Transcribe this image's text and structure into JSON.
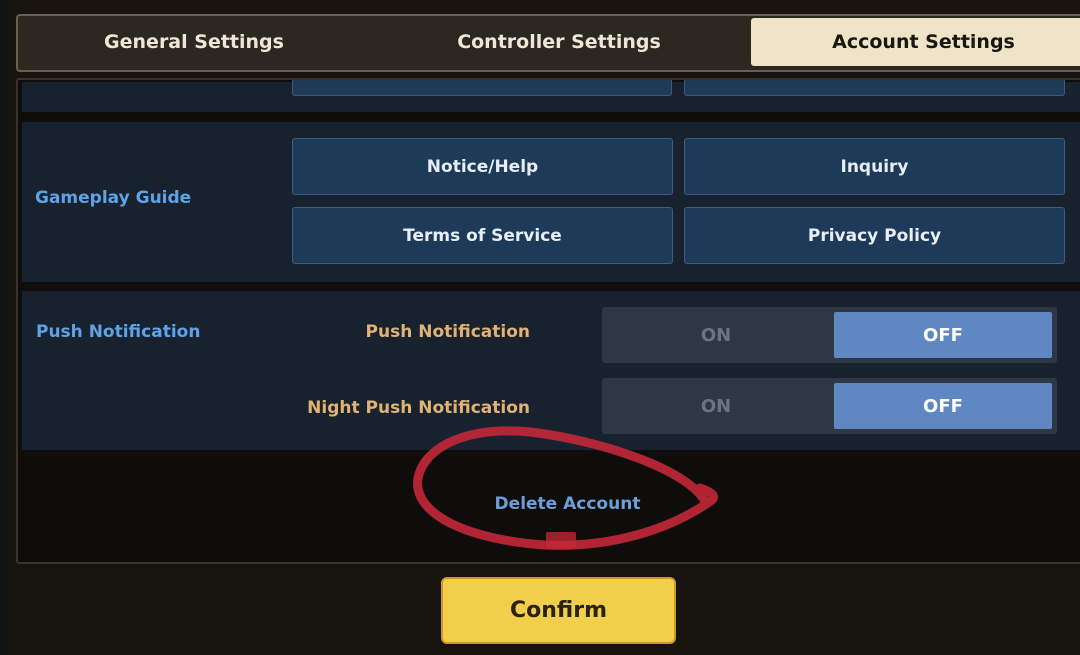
{
  "tabs": [
    {
      "label": "General Settings",
      "active": false
    },
    {
      "label": "Controller Settings",
      "active": false
    },
    {
      "label": "Account Settings",
      "active": true
    }
  ],
  "guide": {
    "label": "Gameplay Guide",
    "buttons": [
      "Notice/Help",
      "Inquiry",
      "Terms of Service",
      "Privacy Policy"
    ]
  },
  "push": {
    "label": "Push Notification",
    "rows": [
      {
        "label": "Push Notification",
        "on": "ON",
        "off": "OFF",
        "selected": "OFF"
      },
      {
        "label": "Night Push Notification",
        "on": "ON",
        "off": "OFF",
        "selected": "OFF"
      }
    ]
  },
  "delete_account": "Delete Account",
  "confirm": "Confirm",
  "colors": {
    "accent_blue": "#5fa3e6",
    "label_orange": "#e0b274",
    "toggle_selected": "#5f87c2",
    "confirm_yellow": "#f2cf4b",
    "annotation_red": "#c8283a"
  }
}
